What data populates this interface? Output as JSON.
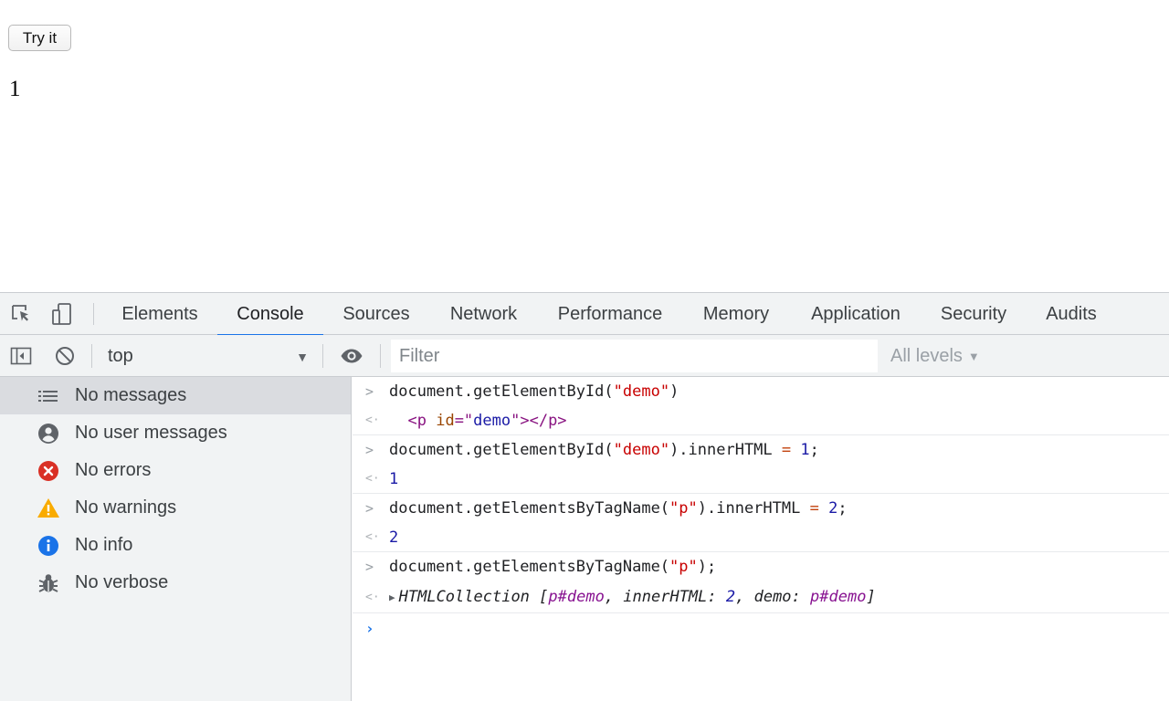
{
  "page": {
    "button_label": "Try it",
    "demo_text": "1"
  },
  "devtools": {
    "tabs": [
      "Elements",
      "Console",
      "Sources",
      "Network",
      "Performance",
      "Memory",
      "Application",
      "Security",
      "Audits"
    ],
    "active_tab": "Console",
    "toolbar": {
      "context": "top",
      "filter_placeholder": "Filter",
      "levels_label": "All levels"
    },
    "sidebar": {
      "items": [
        {
          "label": "No messages",
          "icon": "list-icon",
          "selected": true
        },
        {
          "label": "No user messages",
          "icon": "user-icon"
        },
        {
          "label": "No errors",
          "icon": "error-icon",
          "color": "#d93025"
        },
        {
          "label": "No warnings",
          "icon": "warning-icon",
          "color": "#f9ab00"
        },
        {
          "label": "No info",
          "icon": "info-icon",
          "color": "#1a73e8"
        },
        {
          "label": "No verbose",
          "icon": "bug-icon"
        }
      ]
    },
    "console": {
      "lines": [
        {
          "kind": "input",
          "parts": [
            {
              "t": "document.getElementById("
            },
            {
              "t": "\"demo\"",
              "c": "str"
            },
            {
              "t": ")"
            }
          ]
        },
        {
          "kind": "output",
          "parts": [
            {
              "t": "  "
            },
            {
              "t": "<p ",
              "c": "tag"
            },
            {
              "t": "id",
              "c": "attr"
            },
            {
              "t": "=\"",
              "c": "tag"
            },
            {
              "t": "demo",
              "c": "attrv"
            },
            {
              "t": "\"></p>",
              "c": "tag"
            }
          ]
        },
        {
          "kind": "input",
          "parts": [
            {
              "t": "document.getElementById("
            },
            {
              "t": "\"demo\"",
              "c": "str"
            },
            {
              "t": ").innerHTML "
            },
            {
              "t": "=",
              "c": "kw"
            },
            {
              "t": " "
            },
            {
              "t": "1",
              "c": "num"
            },
            {
              "t": ";"
            }
          ]
        },
        {
          "kind": "output",
          "parts": [
            {
              "t": "1",
              "c": "num"
            }
          ]
        },
        {
          "kind": "input",
          "parts": [
            {
              "t": "document.getElementsByTagName("
            },
            {
              "t": "\"p\"",
              "c": "str"
            },
            {
              "t": ").innerHTML "
            },
            {
              "t": "=",
              "c": "kw"
            },
            {
              "t": " "
            },
            {
              "t": "2",
              "c": "num"
            },
            {
              "t": ";"
            }
          ]
        },
        {
          "kind": "output",
          "parts": [
            {
              "t": "2",
              "c": "num"
            }
          ]
        },
        {
          "kind": "input",
          "parts": [
            {
              "t": "document.getElementsByTagName("
            },
            {
              "t": "\"p\"",
              "c": "str"
            },
            {
              "t": ");"
            }
          ]
        },
        {
          "kind": "output-expand",
          "parts": [
            {
              "t": "HTMLCollection [",
              "c": "ital"
            },
            {
              "t": "p#demo",
              "c": "obj ital"
            },
            {
              "t": ", innerHTML: ",
              "c": "ital"
            },
            {
              "t": "2",
              "c": "num ital"
            },
            {
              "t": ", demo: ",
              "c": "ital"
            },
            {
              "t": "p#demo",
              "c": "obj ital"
            },
            {
              "t": "]",
              "c": "ital"
            }
          ]
        }
      ]
    }
  }
}
